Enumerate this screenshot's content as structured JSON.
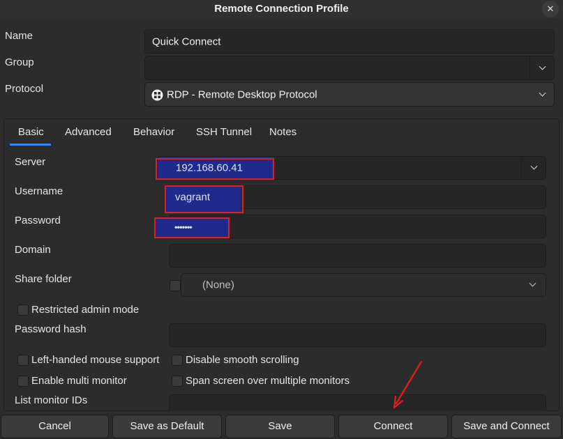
{
  "window": {
    "title": "Remote Connection Profile",
    "close_symbol": "✕"
  },
  "profile": {
    "name_label": "Name",
    "name_value": "Quick Connect",
    "group_label": "Group",
    "group_value": "",
    "protocol_label": "Protocol",
    "protocol_value": "RDP - Remote Desktop Protocol",
    "protocol_icon": "rdp-protocol-icon"
  },
  "tabs": [
    {
      "label": "Basic",
      "active": true
    },
    {
      "label": "Advanced"
    },
    {
      "label": "Behavior"
    },
    {
      "label": "SSH Tunnel"
    },
    {
      "label": "Notes"
    }
  ],
  "basic": {
    "server_label": "Server",
    "server_value": "192.168.60.41",
    "username_label": "Username",
    "username_value": "vagrant",
    "password_label": "Password",
    "password_value": "•••••••",
    "domain_label": "Domain",
    "domain_value": "",
    "share_folder_label": "Share folder",
    "share_folder_value": "(None)",
    "restricted_admin_label": "Restricted admin mode",
    "password_hash_label": "Password hash",
    "left_handed_label": "Left-handed mouse support",
    "disable_smooth_label": "Disable smooth scrolling",
    "multi_monitor_label": "Enable multi monitor",
    "span_screen_label": "Span screen over multiple monitors",
    "monitor_ids_label": "List monitor IDs"
  },
  "buttons": {
    "cancel": "Cancel",
    "save_default": "Save as Default",
    "save": "Save",
    "connect": "Connect",
    "save_connect": "Save and Connect"
  },
  "colors": {
    "highlight": "#1f2a8a",
    "annotation_red": "#e01f1f",
    "tab_accent": "#3584e4"
  }
}
